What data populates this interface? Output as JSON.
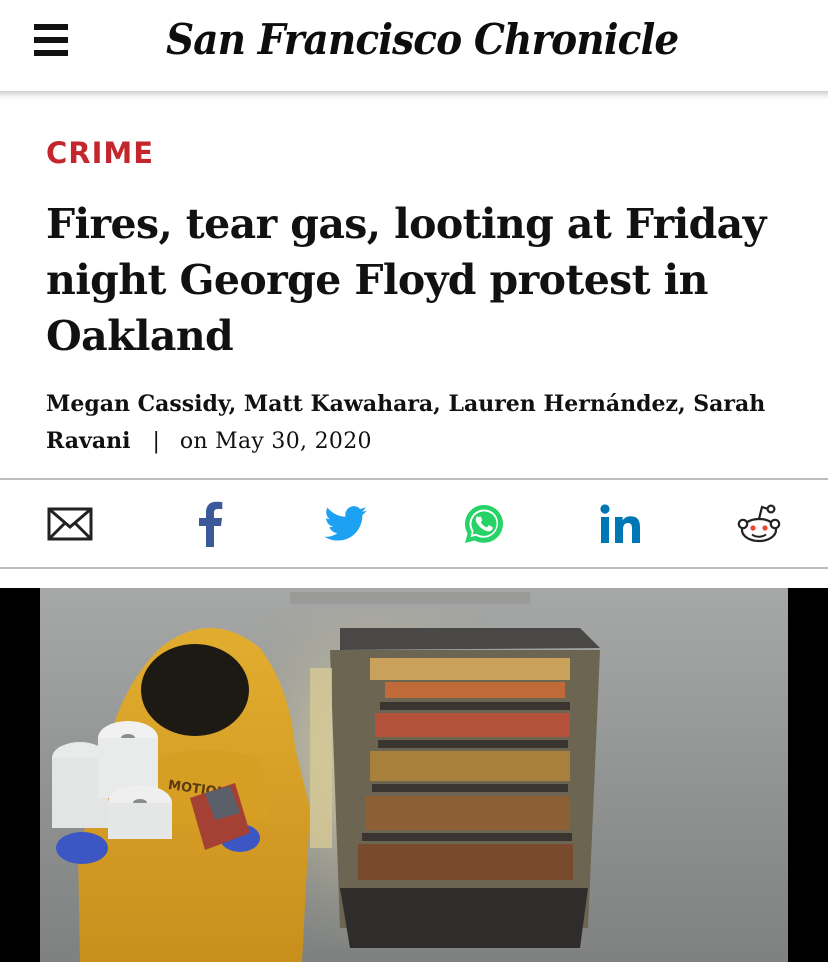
{
  "header": {
    "masthead": "San Francisco Chronicle",
    "menu_icon": "hamburger-menu-icon"
  },
  "article": {
    "section": "CRIME",
    "headline": "Fires, tear gas, looting at Friday night George Floyd protest in Oakland",
    "authors": "Megan Cassidy, Matt Kawahara, Lauren Hernández, Sarah Ravani",
    "separator": "|",
    "date": "on May 30, 2020"
  },
  "share": {
    "items": [
      {
        "icon": "email-icon"
      },
      {
        "icon": "facebook-icon",
        "glyph": "f"
      },
      {
        "icon": "twitter-icon"
      },
      {
        "icon": "whatsapp-icon"
      },
      {
        "icon": "linkedin-icon",
        "glyph": "in"
      },
      {
        "icon": "reddit-icon"
      }
    ]
  },
  "colors": {
    "section_red": "#c4262e",
    "facebook_blue": "#3b5998",
    "twitter_blue": "#1da1f2",
    "whatsapp_green": "#25d366",
    "linkedin_blue": "#0077b5",
    "hoodie_yellow": "#d7a126"
  },
  "hero": {
    "shirt_text": "MOTION"
  }
}
